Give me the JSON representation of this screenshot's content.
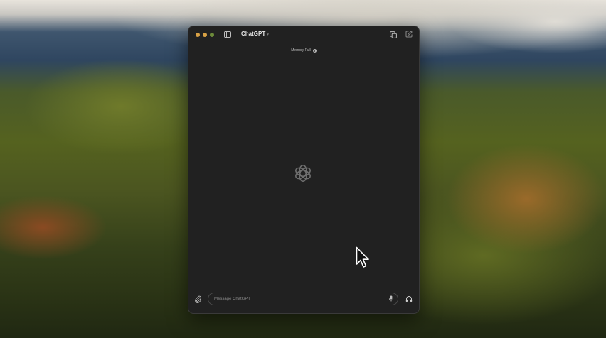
{
  "window": {
    "title": "ChatGPT",
    "title_chevron": "›"
  },
  "titlebar": {
    "traffic_lights": [
      "close",
      "minimize",
      "maximize"
    ],
    "icons": [
      "sidebar-icon",
      "share-icon",
      "new-chat-icon"
    ]
  },
  "memory": {
    "label": "Memory Full",
    "icon": "info-icon"
  },
  "main": {
    "logo": "openai-logo-icon"
  },
  "composer": {
    "placeholder": "Message ChatGPT",
    "attach_icon": "paperclip-icon",
    "mic_icon": "microphone-icon",
    "voice_icon": "headphones-icon"
  },
  "colors": {
    "window_bg": "#212121",
    "traffic_close": "#d8a145",
    "traffic_min": "#d8a145",
    "traffic_max": "#6c8a3a"
  }
}
